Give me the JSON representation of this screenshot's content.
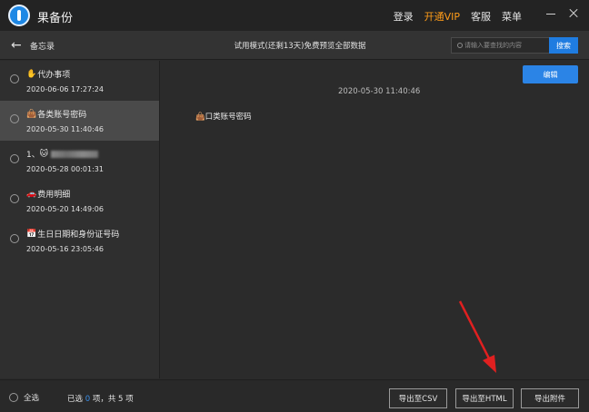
{
  "app": {
    "title": "果备份"
  },
  "top_links": [
    {
      "label": "登录"
    },
    {
      "label": "开通VIP"
    },
    {
      "label": "客服"
    },
    {
      "label": "菜单"
    }
  ],
  "header": {
    "back_label": "备忘录",
    "trial_text": "试用模式(还剩13天)免费预览全部数据",
    "search_placeholder": "请输入要查找的内容",
    "search_button": "搜索"
  },
  "notes": [
    {
      "emoji": "✋",
      "title": "代办事项",
      "date": "2020-06-06 17:27:24",
      "selected": false
    },
    {
      "emoji": "👜",
      "title": "各类账号密码",
      "date": "2020-05-30 11:40:46",
      "selected": true
    },
    {
      "emoji": "🐱",
      "title": "1、",
      "date": "2020-05-28 00:01:31",
      "selected": false,
      "blurred": true
    },
    {
      "emoji": "🚗",
      "title": "费用明细",
      "date": "2020-05-20 14:49:06",
      "selected": false
    },
    {
      "emoji": "📅",
      "title": "生日日期和身份证号码",
      "date": "2020-05-16 23:05:46",
      "selected": false
    }
  ],
  "detail": {
    "edit_button": "编辑",
    "date": "2020-05-30 11:40:46",
    "body": "👜口类账号密码"
  },
  "footer": {
    "select_all": "全选",
    "selected_prefix": "已选",
    "selected_count": "0",
    "selected_suffix": "项，共 5 项",
    "export_csv": "导出至CSV",
    "export_html": "导出至HTML",
    "export_attachments": "导出附件"
  },
  "colors": {
    "accent": "#2b84e6",
    "vip": "#ff9c19",
    "annotation_arrow": "#e02020"
  }
}
